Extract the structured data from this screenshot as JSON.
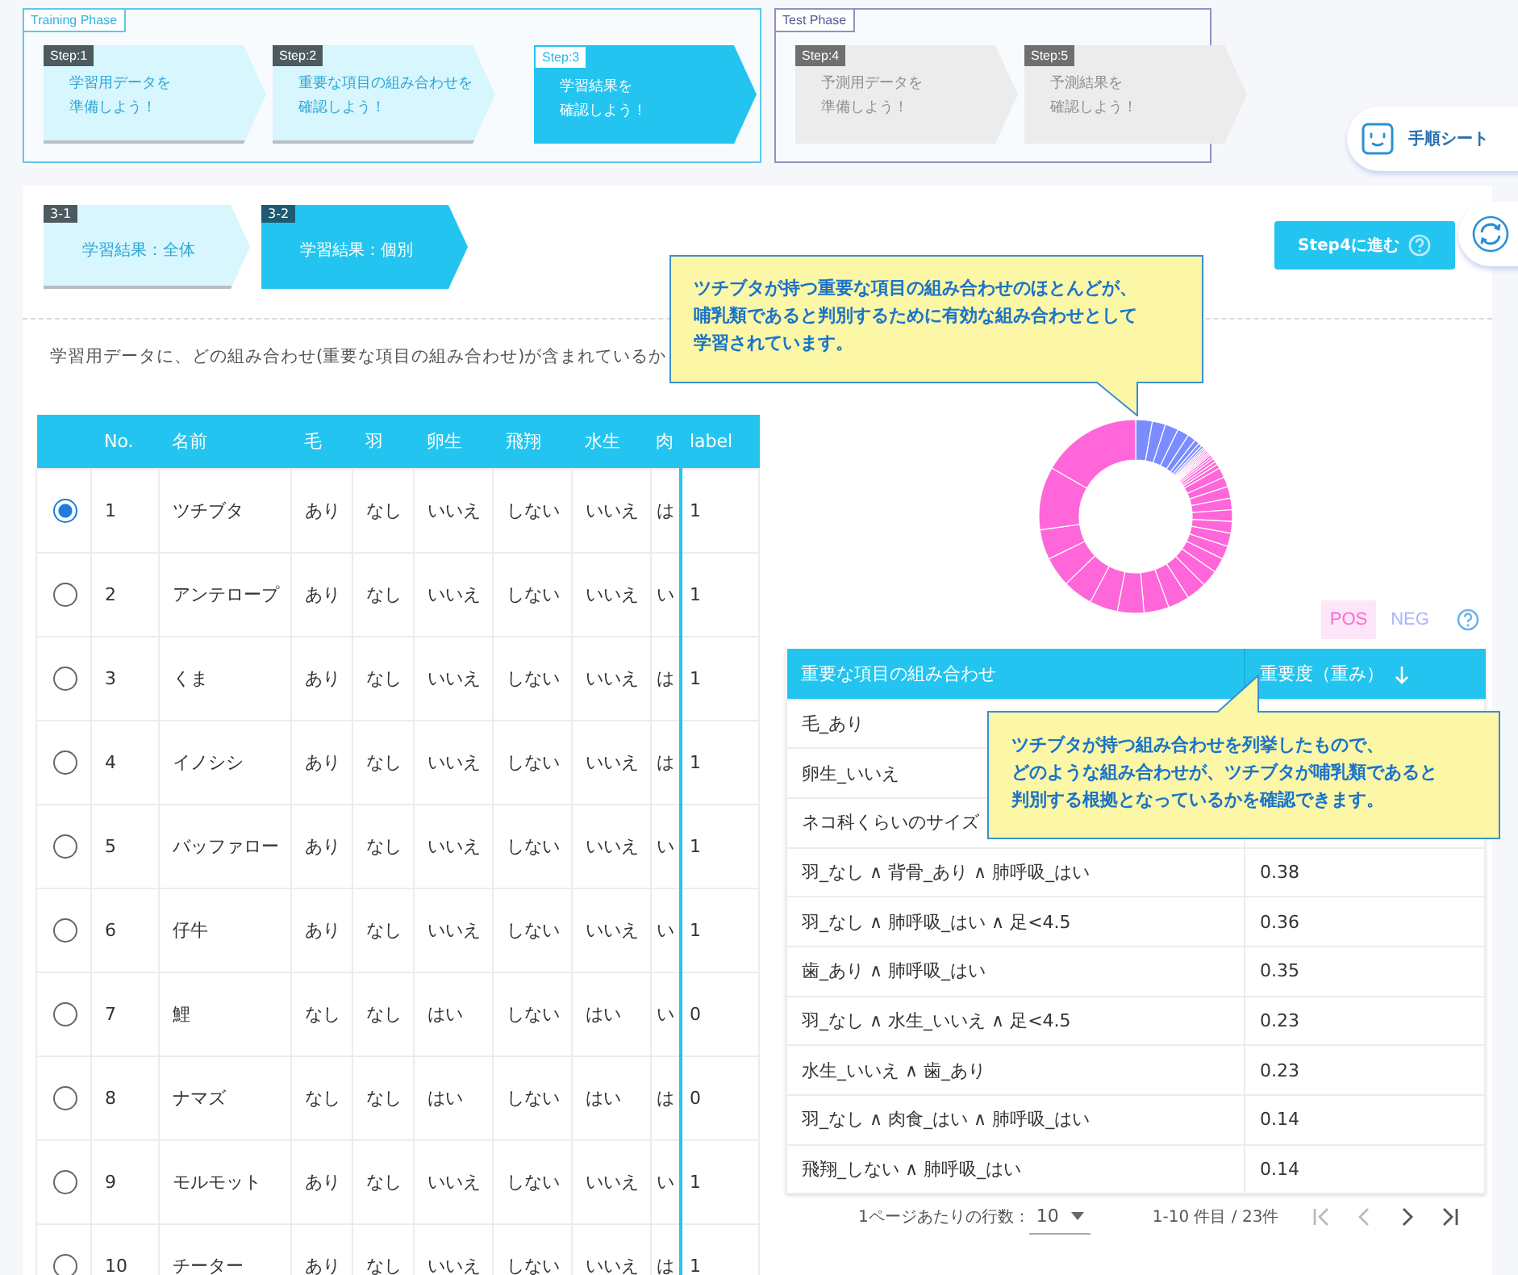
{
  "phases": [
    {
      "title": "Training Phase",
      "kind": "training",
      "steps": [
        {
          "tag": "Step:1",
          "label": [
            "学習用データを",
            "準備しよう！"
          ],
          "selected": false,
          "disabled": false
        },
        {
          "tag": "Step:2",
          "label": [
            "重要な項目の組み合わせを",
            "確認しよう！"
          ],
          "selected": false,
          "disabled": false
        },
        {
          "tag": "Step:3",
          "label": [
            "学習結果を",
            "確認しよう！"
          ],
          "selected": true,
          "disabled": false
        }
      ]
    },
    {
      "title": "Test Phase",
      "kind": "test",
      "steps": [
        {
          "tag": "Step:4",
          "label": [
            "予測用データを",
            "準備しよう！"
          ],
          "selected": false,
          "disabled": true
        },
        {
          "tag": "Step:5",
          "label": [
            "予測結果を",
            "確認しよう！"
          ],
          "selected": false,
          "disabled": true
        }
      ]
    }
  ],
  "help_sheet_button": {
    "label": "手順シート"
  },
  "substeps": [
    {
      "tag": "3-1",
      "label": "学習結果：全体",
      "selected": false
    },
    {
      "tag": "3-2",
      "label": "学習結果：個別",
      "selected": true
    }
  ],
  "next_button": {
    "label": "Step4に進む"
  },
  "description": "学習用データに、どの組み合わせ(重要な項目の組み合わせ)が含まれているか",
  "data_table": {
    "columns": [
      "No.",
      "名前",
      "毛",
      "羽",
      "卵生",
      "飛翔",
      "水生",
      "肉",
      "label"
    ],
    "rows": [
      {
        "selected": true,
        "cells": [
          "1",
          "ツチブタ",
          "あり",
          "なし",
          "いいえ",
          "しない",
          "いいえ",
          "は",
          "1"
        ]
      },
      {
        "selected": false,
        "cells": [
          "2",
          "アンテロープ",
          "あり",
          "なし",
          "いいえ",
          "しない",
          "いいえ",
          "い",
          "1"
        ]
      },
      {
        "selected": false,
        "cells": [
          "3",
          "くま",
          "あり",
          "なし",
          "いいえ",
          "しない",
          "いいえ",
          "は",
          "1"
        ]
      },
      {
        "selected": false,
        "cells": [
          "4",
          "イノシシ",
          "あり",
          "なし",
          "いいえ",
          "しない",
          "いいえ",
          "は",
          "1"
        ]
      },
      {
        "selected": false,
        "cells": [
          "5",
          "バッファロー",
          "あり",
          "なし",
          "いいえ",
          "しない",
          "いいえ",
          "い",
          "1"
        ]
      },
      {
        "selected": false,
        "cells": [
          "6",
          "仔牛",
          "あり",
          "なし",
          "いいえ",
          "しない",
          "いいえ",
          "い",
          "1"
        ]
      },
      {
        "selected": false,
        "cells": [
          "7",
          "鯉",
          "なし",
          "なし",
          "はい",
          "しない",
          "はい",
          "い",
          "0"
        ]
      },
      {
        "selected": false,
        "cells": [
          "8",
          "ナマズ",
          "なし",
          "なし",
          "はい",
          "しない",
          "はい",
          "は",
          "0"
        ]
      },
      {
        "selected": false,
        "cells": [
          "9",
          "モルモット",
          "あり",
          "なし",
          "いいえ",
          "しない",
          "いいえ",
          "い",
          "1"
        ]
      },
      {
        "selected": false,
        "cells": [
          "10",
          "チーター",
          "あり",
          "なし",
          "いいえ",
          "しない",
          "いいえ",
          "は",
          "1"
        ]
      }
    ]
  },
  "chart_toggle": [
    {
      "label": "POS",
      "selected": true
    },
    {
      "label": "NEG",
      "selected": false
    }
  ],
  "combo_table": {
    "columns": [
      "重要な項目の組み合わせ",
      "重要度（重み）"
    ],
    "rows": [
      {
        "combination": "毛_あり"
      },
      {
        "combination": "卵生_いいえ"
      },
      {
        "combination": "ネコ科くらいのサイズ"
      },
      {
        "combination": "羽_なし ∧ 背骨_あり ∧ 肺呼吸_はい",
        "weight": "0.38"
      },
      {
        "combination": "羽_なし ∧ 肺呼吸_はい ∧ 足<4.5",
        "weight": "0.36"
      },
      {
        "combination": "歯_あり ∧ 肺呼吸_はい",
        "weight": "0.35"
      },
      {
        "combination": "羽_なし ∧ 水生_いいえ ∧ 足<4.5",
        "weight": "0.23"
      },
      {
        "combination": "水生_いいえ ∧ 歯_あり",
        "weight": "0.23"
      },
      {
        "combination": "羽_なし ∧ 肉食_はい ∧ 肺呼吸_はい",
        "weight": "0.14"
      },
      {
        "combination": "飛翔_しない ∧ 肺呼吸_はい",
        "weight": "0.14"
      }
    ]
  },
  "pagination": {
    "rows_per_page_label": "1ページあたりの行数：",
    "rows_per_page": "10",
    "range": "1-10 件目 / 23件"
  },
  "callouts": [
    {
      "lines": [
        "ツチブタが持つ重要な項目の組み合わせのほとんどが、",
        "哺乳類であると判別するために有効な組み合わせとして",
        "学習されています。"
      ]
    },
    {
      "lines": [
        "ツチブタが持つ組み合わせを列挙したもので、",
        "どのような組み合わせが、ツチブタが哺乳類であると",
        "判別する根拠となっているかを確認できます。"
      ]
    }
  ]
}
